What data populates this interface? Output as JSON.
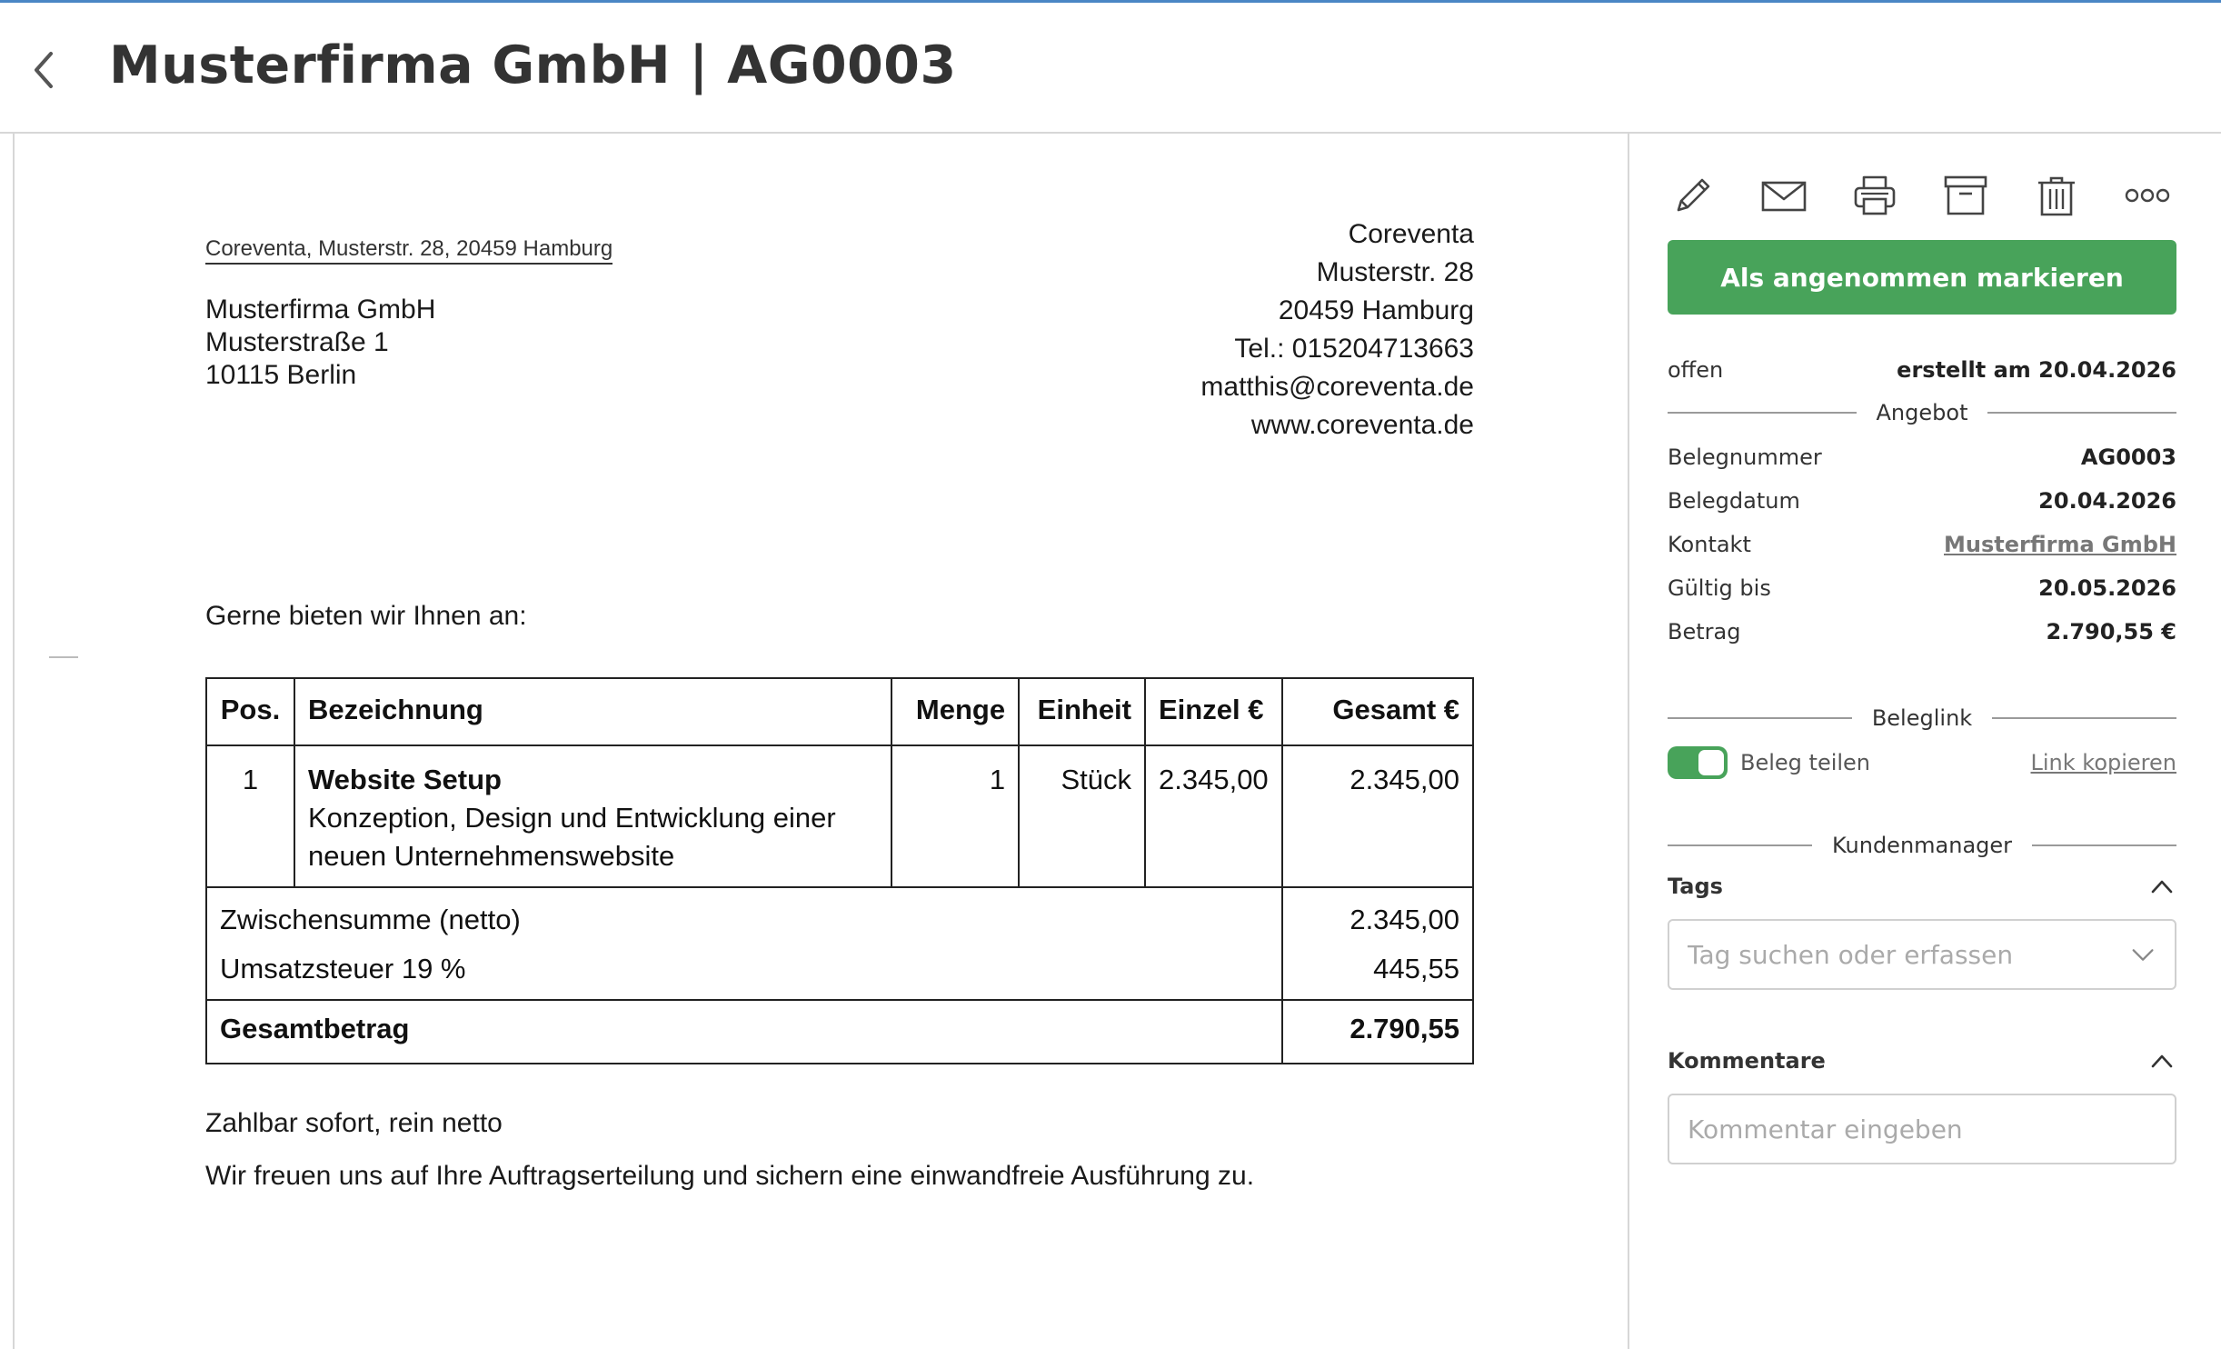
{
  "header": {
    "title": "Musterfirma GmbH | AG0003"
  },
  "document": {
    "sender_line": "Coreventa, Musterstr. 28, 20459 Hamburg",
    "recipient": {
      "name": "Musterfirma GmbH",
      "street": "Musterstraße 1",
      "city": "10115 Berlin"
    },
    "company": {
      "name": "Coreventa",
      "street": "Musterstr. 28",
      "city": "20459 Hamburg",
      "phone": "Tel.: 015204713663",
      "email": "matthis@coreventa.de",
      "web": "www.coreventa.de"
    },
    "intro": "Gerne bieten wir Ihnen an:",
    "table": {
      "headers": {
        "pos": "Pos.",
        "bezeichnung": "Bezeichnung",
        "menge": "Menge",
        "einheit": "Einheit",
        "einzel": "Einzel €",
        "gesamt": "Gesamt €"
      },
      "items": [
        {
          "pos": "1",
          "title": "Website Setup",
          "description": "Konzeption, Design und Entwicklung einer neuen Unternehmenswebsite",
          "menge": "1",
          "einheit": "Stück",
          "einzel": "2.345,00",
          "gesamt": "2.345,00"
        }
      ],
      "subtotal_label": "Zwischensumme (netto)",
      "subtotal_value": "2.345,00",
      "tax_label": "Umsatzsteuer 19 %",
      "tax_value": "445,55",
      "total_label": "Gesamtbetrag",
      "total_value": "2.790,55"
    },
    "payment_terms": "Zahlbar sofort, rein netto",
    "closing": "Wir freuen uns auf Ihre Auftragserteilung und sichern eine einwandfreie Ausführung zu."
  },
  "panel": {
    "toolbar": {
      "icons": [
        "pencil-icon",
        "mail-icon",
        "printer-icon",
        "archive-icon",
        "trash-icon",
        "more-icon"
      ]
    },
    "accept_button": "Als angenommen markieren",
    "status": "offen",
    "created": "erstellt am 20.04.2026",
    "section_offer": "Angebot",
    "details": {
      "belegnummer_label": "Belegnummer",
      "belegnummer_value": "AG0003",
      "belegdatum_label": "Belegdatum",
      "belegdatum_value": "20.04.2026",
      "kontakt_label": "Kontakt",
      "kontakt_value": "Musterfirma GmbH",
      "gueltig_label": "Gültig bis",
      "gueltig_value": "20.05.2026",
      "betrag_label": "Betrag",
      "betrag_value": "2.790,55 €"
    },
    "section_link": "Beleglink",
    "share_label": "Beleg teilen",
    "share_enabled": true,
    "copy_link": "Link kopieren",
    "section_customer": "Kundenmanager",
    "tags_title": "Tags",
    "tags_placeholder": "Tag suchen oder erfassen",
    "comments_title": "Kommentare",
    "comments_placeholder": "Kommentar eingeben",
    "colors": {
      "accent_green": "#48a35a",
      "top_line": "#4a86c5"
    }
  }
}
